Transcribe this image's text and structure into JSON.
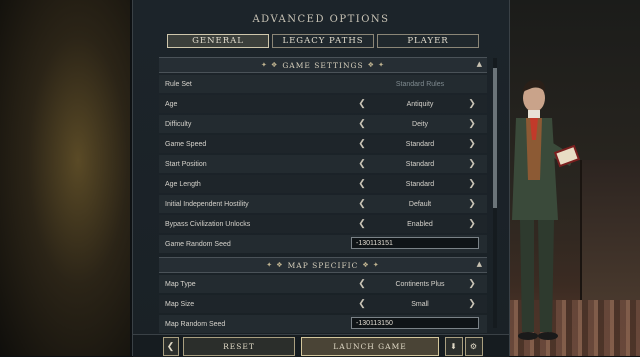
{
  "title": "ADVANCED OPTIONS",
  "tabs": [
    {
      "label": "GENERAL",
      "active": true
    },
    {
      "label": "LEGACY PATHS",
      "active": false
    },
    {
      "label": "PLAYER",
      "active": false
    }
  ],
  "sections": {
    "game_settings": "GAME SETTINGS",
    "map_specific": "MAP SPECIFIC"
  },
  "rows": {
    "rule_set": {
      "label": "Rule Set",
      "value": "Standard Rules"
    },
    "age": {
      "label": "Age",
      "value": "Antiquity"
    },
    "difficulty": {
      "label": "Difficulty",
      "value": "Deity"
    },
    "game_speed": {
      "label": "Game Speed",
      "value": "Standard"
    },
    "start_position": {
      "label": "Start Position",
      "value": "Standard"
    },
    "age_length": {
      "label": "Age Length",
      "value": "Standard"
    },
    "independent_hostility": {
      "label": "Initial Independent Hostility",
      "value": "Default"
    },
    "bypass_unlocks": {
      "label": "Bypass Civilization Unlocks",
      "value": "Enabled"
    },
    "game_seed": {
      "label": "Game Random Seed",
      "value": "-130113151"
    },
    "map_type": {
      "label": "Map Type",
      "value": "Continents Plus"
    },
    "map_size": {
      "label": "Map Size",
      "value": "Small"
    },
    "map_seed": {
      "label": "Map Random Seed",
      "value": "-130113150"
    }
  },
  "buttons": {
    "back": "❮",
    "reset": "RESET",
    "launch": "LAUNCH GAME"
  },
  "icons": {
    "arrow_left": "❮",
    "arrow_right": "❯",
    "section_deco_left": "✦ ❖",
    "section_deco_right": "❖ ✦",
    "caret": "▲",
    "download": "⬇",
    "gear": "⚙"
  },
  "colors": {
    "panel": "#1c242a",
    "accent": "#c0b491",
    "text": "#d6d3cc"
  }
}
